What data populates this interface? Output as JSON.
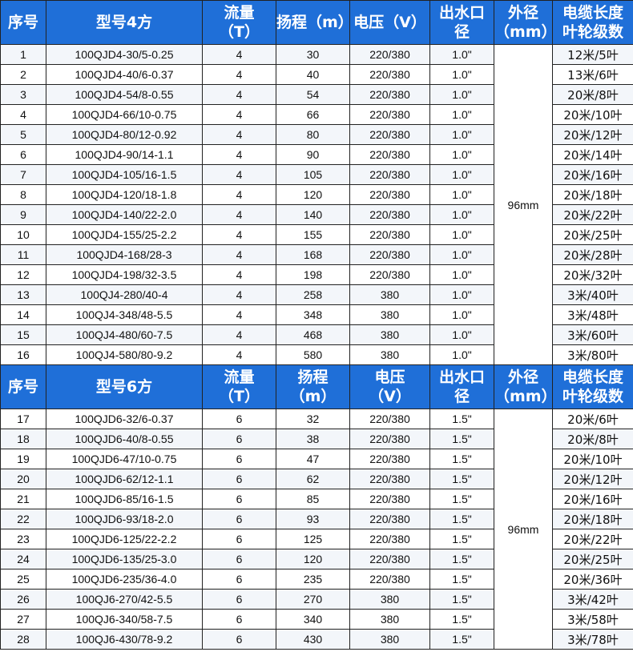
{
  "headers_4": [
    "序号",
    "型号4方",
    "流量",
    "（T）",
    "扬程（m）",
    "",
    "电压（V）",
    "",
    "出水口",
    "径",
    "外径",
    "（mm）",
    "电缆长度",
    "叶轮级数"
  ],
  "headers_6": [
    "序号",
    "型号6方",
    "流量",
    "（T）",
    "扬程",
    "（m）",
    "电压",
    "（V）",
    "出水口",
    "径",
    "外径",
    "（mm）",
    "电缆长度",
    "叶轮级数"
  ],
  "outer_diameter_4": "96mm",
  "outer_diameter_6": "96mm",
  "rows_4": [
    [
      "1",
      "100QJD4-30/5-0.25",
      "4",
      "30",
      "220/380",
      "1.0\"",
      "12米/5叶"
    ],
    [
      "2",
      "100QJD4-40/6-0.37",
      "4",
      "40",
      "220/380",
      "1.0\"",
      "13米/6叶"
    ],
    [
      "3",
      "100QJD4-54/8-0.55",
      "4",
      "54",
      "220/380",
      "1.0\"",
      "20米/8叶"
    ],
    [
      "4",
      "100QJD4-66/10-0.75",
      "4",
      "66",
      "220/380",
      "1.0\"",
      "20米/10叶"
    ],
    [
      "5",
      "100QJD4-80/12-0.92",
      "4",
      "80",
      "220/380",
      "1.0\"",
      "20米/12叶"
    ],
    [
      "6",
      "100QJD4-90/14-1.1",
      "4",
      "90",
      "220/380",
      "1.0\"",
      "20米/14叶"
    ],
    [
      "7",
      "100QJD4-105/16-1.5",
      "4",
      "105",
      "220/380",
      "1.0\"",
      "20米/16叶"
    ],
    [
      "8",
      "100QJD4-120/18-1.8",
      "4",
      "120",
      "220/380",
      "1.0\"",
      "20米/18叶"
    ],
    [
      "9",
      "100QJD4-140/22-2.0",
      "4",
      "140",
      "220/380",
      "1.0\"",
      "20米/22叶"
    ],
    [
      "10",
      "100QJD4-155/25-2.2",
      "4",
      "155",
      "220/380",
      "1.0\"",
      "20米/25叶"
    ],
    [
      "11",
      "100QJD4-168/28-3",
      "4",
      "168",
      "220/380",
      "1.0\"",
      "20米/28叶"
    ],
    [
      "12",
      "100QJD4-198/32-3.5",
      "4",
      "198",
      "220/380",
      "1.0\"",
      "20米/32叶"
    ],
    [
      "13",
      "100QJ4-280/40-4",
      "4",
      "258",
      "380",
      "1.0\"",
      "3米/40叶"
    ],
    [
      "14",
      "100QJ4-348/48-5.5",
      "4",
      "348",
      "380",
      "1.0\"",
      "3米/48叶"
    ],
    [
      "15",
      "100QJ4-480/60-7.5",
      "4",
      "468",
      "380",
      "1.0\"",
      "3米/60叶"
    ],
    [
      "16",
      "100QJ4-580/80-9.2",
      "4",
      "580",
      "380",
      "1.0\"",
      "3米/80叶"
    ]
  ],
  "rows_6": [
    [
      "17",
      "100QJD6-32/6-0.37",
      "6",
      "32",
      "220/380",
      "1.5\"",
      "20米/6叶"
    ],
    [
      "18",
      "100QJD6-40/8-0.55",
      "6",
      "38",
      "220/380",
      "1.5\"",
      "20米/8叶"
    ],
    [
      "19",
      "100QJD6-47/10-0.75",
      "6",
      "47",
      "220/380",
      "1.5\"",
      "20米/10叶"
    ],
    [
      "20",
      "100QJD6-62/12-1.1",
      "6",
      "62",
      "220/380",
      "1.5\"",
      "20米/12叶"
    ],
    [
      "21",
      "100QJD6-85/16-1.5",
      "6",
      "85",
      "220/380",
      "1.5\"",
      "20米/16叶"
    ],
    [
      "22",
      "100QJD6-93/18-2.0",
      "6",
      "93",
      "220/380",
      "1.5\"",
      "20米/18叶"
    ],
    [
      "23",
      "100QJD6-125/22-2.2",
      "6",
      "125",
      "220/380",
      "1.5\"",
      "20米/22叶"
    ],
    [
      "24",
      "100QJD6-135/25-3.0",
      "6",
      "120",
      "220/380",
      "1.5\"",
      "20米/25叶"
    ],
    [
      "25",
      "100QJD6-235/36-4.0",
      "6",
      "235",
      "220/380",
      "1.5\"",
      "20米/36叶"
    ],
    [
      "26",
      "100QJ6-270/42-5.5",
      "6",
      "270",
      "380",
      "1.5\"",
      "3米/42叶"
    ],
    [
      "27",
      "100QJ6-340/58-7.5",
      "6",
      "340",
      "380",
      "1.5\"",
      "3米/58叶"
    ],
    [
      "28",
      "100QJ6-430/78-9.2",
      "6",
      "430",
      "380",
      "1.5\"",
      "3米/78叶"
    ]
  ],
  "colors": {
    "header_bg": "#1f6fd8",
    "header_text": "#ffffff",
    "grid": "#222222"
  }
}
